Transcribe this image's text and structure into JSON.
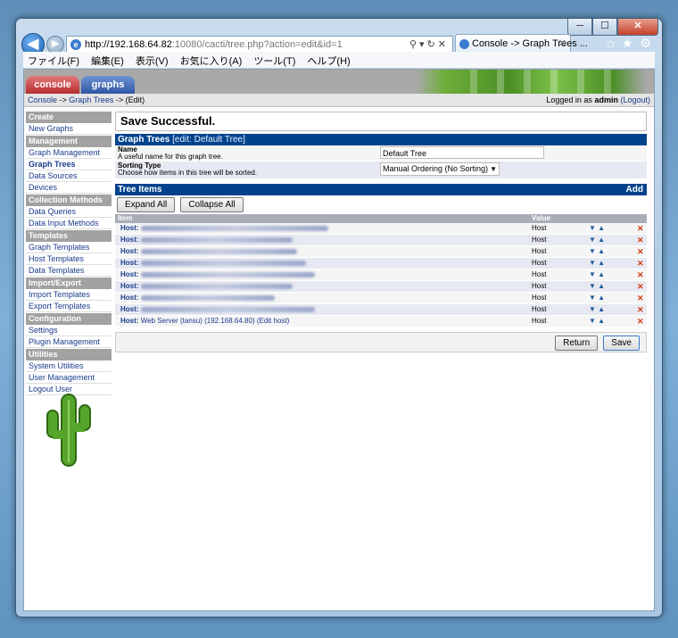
{
  "browser": {
    "url_host": "http://192.168.64.82",
    "url_rest": ":10080/cacti/tree.php?action=edit&id=1",
    "tab_title": "Console -> Graph Trees ...",
    "menu": [
      "ファイル(F)",
      "編集(E)",
      "表示(V)",
      "お気に入り(A)",
      "ツール(T)",
      "ヘルプ(H)"
    ],
    "controls": {
      "min": "─",
      "max": "☐",
      "close": "✕"
    }
  },
  "header": {
    "tab_console": "console",
    "tab_graphs": "graphs"
  },
  "breadcrumb": {
    "console": "Console",
    "sep1": " -> ",
    "graph_trees": "Graph Trees",
    "sep2": " -> (Edit)",
    "logged_prefix": "Logged in as ",
    "user": "admin",
    "logout": "(Logout)"
  },
  "sidebar": {
    "sections": [
      {
        "title": "Create",
        "items": [
          "New Graphs"
        ]
      },
      {
        "title": "Management",
        "items": [
          "Graph Management",
          "Graph Trees",
          "Data Sources",
          "Devices"
        ]
      },
      {
        "title": "Collection Methods",
        "items": [
          "Data Queries",
          "Data Input Methods"
        ]
      },
      {
        "title": "Templates",
        "items": [
          "Graph Templates",
          "Host Templates",
          "Data Templates"
        ]
      },
      {
        "title": "Import/Export",
        "items": [
          "Import Templates",
          "Export Templates"
        ]
      },
      {
        "title": "Configuration",
        "items": [
          "Settings",
          "Plugin Management"
        ]
      },
      {
        "title": "Utilities",
        "items": [
          "System Utilities",
          "User Management",
          "Logout User"
        ]
      }
    ]
  },
  "main": {
    "save_message": "Save Successful.",
    "graph_trees_title": "Graph Trees",
    "graph_trees_sub": " [edit: Default Tree]",
    "name_label": "Name",
    "name_desc": "A useful name for this graph tree.",
    "name_value": "Default Tree",
    "sorting_label": "Sorting Type",
    "sorting_desc": "Choose how items in this tree will be sorted.",
    "sorting_value": "Manual Ordering (No Sorting)",
    "tree_items_title": "Tree Items",
    "add_link": "Add",
    "expand_all": "Expand All",
    "collapse_all": "Collapse All",
    "col_item": "Item",
    "col_value": "Value",
    "row_prefix": "Host:",
    "row_value": "Host",
    "last_row_text": "Web Server (tansu) (192.168.64.80) (Edit host)",
    "return_button": "Return",
    "save_button": "Save"
  }
}
